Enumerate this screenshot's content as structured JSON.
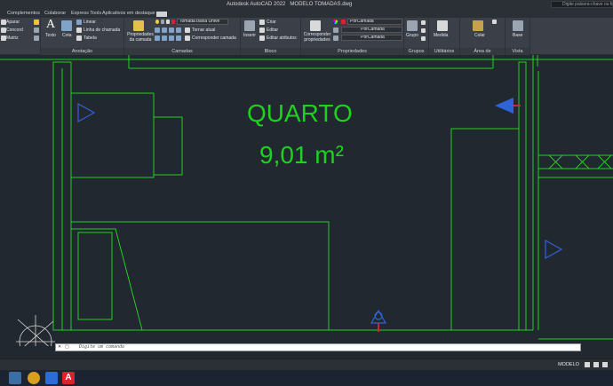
{
  "window": {
    "app_title": "Autodesk AutoCAD 2022",
    "file_name": "MODELO TOMADAS.dwg",
    "search_placeholder": "Digite palavra-chave ou frase"
  },
  "tabs": [
    "Complementos",
    "Colaborar",
    "Express Tools",
    "Aplicativos em destaque"
  ],
  "ribbon": {
    "modify": {
      "items": [
        "Aparar",
        "Concord",
        "Matriz"
      ]
    },
    "annotation": {
      "label": "Anotação",
      "texto": "Texto",
      "cota": "Cota",
      "linear": "Linear",
      "linha_chamada": "Linha de chamada",
      "tabela": "Tabela"
    },
    "layers": {
      "label": "Camadas",
      "propriedades": "Propriedades da camada",
      "current_layer": "Tomada baixa Unive",
      "tornar_atual": "Tornar atual",
      "corresponder": "Corresponder camada"
    },
    "block": {
      "label": "Bloco",
      "inserir": "Inserir",
      "criar": "Criar",
      "editar": "Editar",
      "editar_atributos": "Editar atributos"
    },
    "properties": {
      "label": "Propriedades",
      "corresponder": "Corresponder propriedades",
      "color": "PorCamada",
      "linetype": "PorCamada",
      "lineweight": "PorCamada"
    },
    "groups": {
      "label": "Grupos",
      "grupo": "Grupo"
    },
    "utilities": {
      "label": "Utilitários",
      "medida": "Medida"
    },
    "clipboard": {
      "label": "Área de transferência",
      "colar": "Colar"
    },
    "view": {
      "label": "Vista",
      "base": "Base"
    }
  },
  "drawing": {
    "room_name": "QUARTO",
    "room_area": "9,01 m²",
    "line_color": "#1fd11f",
    "marker_color": "#2f63d8"
  },
  "command_line": {
    "placeholder": "Digite um comando"
  },
  "status_bar": {
    "model_tab": "MODELO"
  },
  "colors": {
    "accent_red": "#d9232a"
  }
}
